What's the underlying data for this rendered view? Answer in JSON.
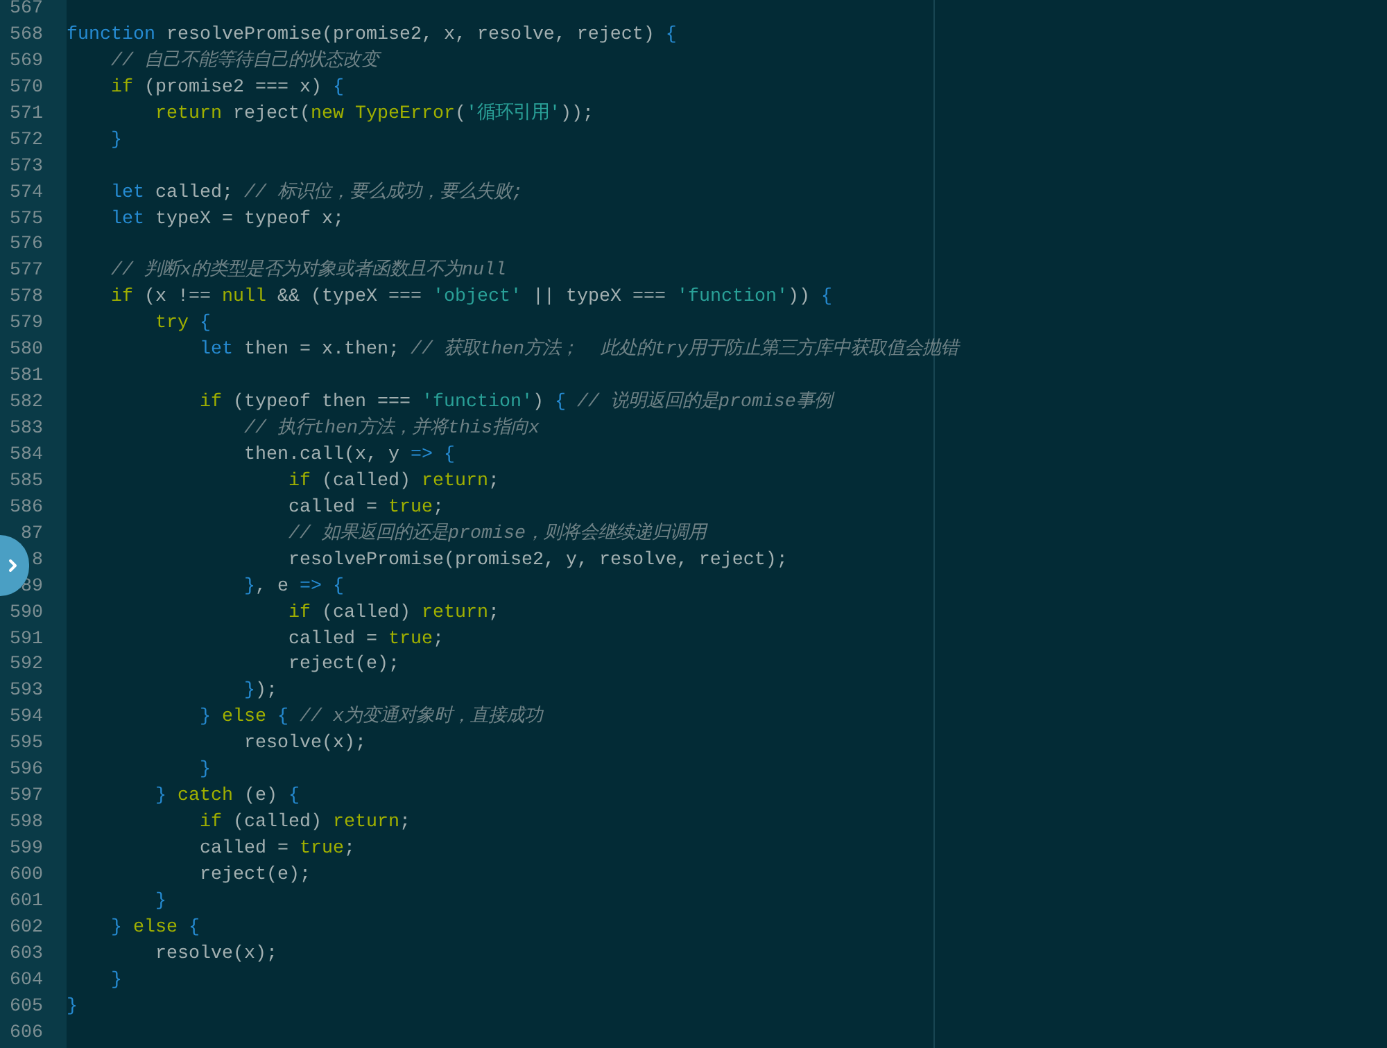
{
  "editor": {
    "lines": [
      {
        "number": "567"
      },
      {
        "number": "568",
        "code": [
          {
            "kind": "keyword",
            "text": "function"
          },
          {
            "kind": "plain",
            "text": " resolvePromise(promise2, x, resolve, reject) "
          },
          {
            "kind": "keyword",
            "text": "{"
          }
        ],
        "children": [
          {
            "number": "569",
            "code": [
              {
                "kind": "comment",
                "text": "// 自己不能等待自己的状态改变"
              }
            ]
          },
          {
            "number": "570",
            "code": [
              {
                "kind": "control",
                "text": "if"
              },
              {
                "kind": "plain",
                "text": " (promise2 === x) "
              },
              {
                "kind": "keyword",
                "text": "{"
              }
            ],
            "children": [
              {
                "number": "571",
                "code": [
                  {
                    "kind": "control",
                    "text": "return"
                  },
                  {
                    "kind": "plain",
                    "text": " reject("
                  },
                  {
                    "kind": "control",
                    "text": "new TypeError"
                  },
                  {
                    "kind": "plain",
                    "text": "("
                  },
                  {
                    "kind": "string",
                    "text": "'循环引用'"
                  },
                  {
                    "kind": "plain",
                    "text": "));"
                  }
                ]
              }
            ]
          },
          {
            "number": "572",
            "code": [
              {
                "kind": "keyword",
                "text": "}"
              }
            ]
          },
          {
            "number": "573"
          },
          {
            "number": "574",
            "code": [
              {
                "kind": "keyword",
                "text": "let"
              },
              {
                "kind": "plain",
                "text": " called; "
              },
              {
                "kind": "comment",
                "text": "// 标识位，要么成功，要么失败;"
              }
            ]
          },
          {
            "number": "575",
            "code": [
              {
                "kind": "keyword",
                "text": "let"
              },
              {
                "kind": "plain",
                "text": " typeX = typeof x;"
              }
            ]
          },
          {
            "number": "576"
          },
          {
            "number": "577",
            "code": [
              {
                "kind": "comment",
                "text": "// 判断x的类型是否为对象或者函数且不为null"
              }
            ]
          },
          {
            "number": "578",
            "code": [
              {
                "kind": "control",
                "text": "if"
              },
              {
                "kind": "plain",
                "text": " (x !== "
              },
              {
                "kind": "control",
                "text": "null"
              },
              {
                "kind": "plain",
                "text": " && (typeX === "
              },
              {
                "kind": "string",
                "text": "'object'"
              },
              {
                "kind": "plain",
                "text": " || typeX === "
              },
              {
                "kind": "string",
                "text": "'function'"
              },
              {
                "kind": "plain",
                "text": ")) "
              },
              {
                "kind": "keyword",
                "text": "{"
              }
            ],
            "children": [
              {
                "number": "579",
                "code": [
                  {
                    "kind": "control",
                    "text": "try"
                  },
                  {
                    "kind": "keyword",
                    "text": " {"
                  }
                ],
                "children": [
                  {
                    "number": "580",
                    "code": [
                      {
                        "kind": "keyword",
                        "text": "let"
                      },
                      {
                        "kind": "plain",
                        "text": " then = x.then; "
                      },
                      {
                        "kind": "comment",
                        "text": "// 获取then方法；  此处的try用于防止第三方库中获取值会抛错"
                      }
                    ]
                  },
                  {
                    "number": "581"
                  },
                  {
                    "number": "582",
                    "code": [
                      {
                        "kind": "control",
                        "text": "if"
                      },
                      {
                        "kind": "plain",
                        "text": " (typeof then === "
                      },
                      {
                        "kind": "string",
                        "text": "'function'"
                      },
                      {
                        "kind": "plain",
                        "text": ") "
                      },
                      {
                        "kind": "keyword",
                        "text": "{"
                      },
                      {
                        "kind": "comment",
                        "text": " // 说明返回的是promise事例"
                      }
                    ],
                    "children": [
                      {
                        "number": "583",
                        "code": [
                          {
                            "kind": "comment",
                            "text": "// 执行then方法，并将this指向x"
                          }
                        ]
                      },
                      {
                        "number": "584",
                        "code": [
                          {
                            "kind": "plain",
                            "text": "then.call(x, y "
                          },
                          {
                            "kind": "keyword",
                            "text": "=> {"
                          }
                        ],
                        "children": [
                          {
                            "number": "585",
                            "code": [
                              {
                                "kind": "control",
                                "text": "if"
                              },
                              {
                                "kind": "plain",
                                "text": " (called) "
                              },
                              {
                                "kind": "control",
                                "text": "return"
                              },
                              {
                                "kind": "plain",
                                "text": ";"
                              }
                            ]
                          },
                          {
                            "number": "586",
                            "code": [
                              {
                                "kind": "plain",
                                "text": "called = "
                              },
                              {
                                "kind": "control",
                                "text": "true"
                              },
                              {
                                "kind": "plain",
                                "text": ";"
                              }
                            ]
                          },
                          {
                            "number": "87",
                            "code": [
                              {
                                "kind": "comment",
                                "text": "// 如果返回的还是promise，则将会继续递归调用"
                              }
                            ]
                          },
                          {
                            "number": "8",
                            "code": [
                              {
                                "kind": "plain",
                                "text": "resolvePromise(promise2, y, resolve, reject);"
                              }
                            ]
                          }
                        ]
                      },
                      {
                        "number": "89",
                        "code": [
                          {
                            "kind": "keyword",
                            "text": "}"
                          },
                          {
                            "kind": "plain",
                            "text": ", e "
                          },
                          {
                            "kind": "keyword",
                            "text": "=> {"
                          }
                        ],
                        "children": [
                          {
                            "number": "590",
                            "code": [
                              {
                                "kind": "control",
                                "text": "if"
                              },
                              {
                                "kind": "plain",
                                "text": " (called) "
                              },
                              {
                                "kind": "control",
                                "text": "return"
                              },
                              {
                                "kind": "plain",
                                "text": ";"
                              }
                            ]
                          },
                          {
                            "number": "591",
                            "code": [
                              {
                                "kind": "plain",
                                "text": "called = "
                              },
                              {
                                "kind": "control",
                                "text": "true"
                              },
                              {
                                "kind": "plain",
                                "text": ";"
                              }
                            ]
                          },
                          {
                            "number": "592",
                            "code": [
                              {
                                "kind": "plain",
                                "text": "reject(e);"
                              }
                            ]
                          }
                        ]
                      },
                      {
                        "number": "593",
                        "code": [
                          {
                            "kind": "keyword",
                            "text": "}"
                          },
                          {
                            "kind": "plain",
                            "text": ");"
                          }
                        ]
                      }
                    ]
                  },
                  {
                    "number": "594",
                    "code": [
                      {
                        "kind": "keyword",
                        "text": "}"
                      },
                      {
                        "kind": "control",
                        "text": " else"
                      },
                      {
                        "kind": "keyword",
                        "text": " {"
                      },
                      {
                        "kind": "comment",
                        "text": " // x为变通对象时，直接成功"
                      }
                    ],
                    "children": [
                      {
                        "number": "595",
                        "code": [
                          {
                            "kind": "plain",
                            "text": "resolve(x);"
                          }
                        ]
                      }
                    ]
                  },
                  {
                    "number": "596",
                    "code": [
                      {
                        "kind": "keyword",
                        "text": "}"
                      }
                    ]
                  }
                ]
              },
              {
                "number": "597",
                "code": [
                  {
                    "kind": "keyword",
                    "text": "}"
                  },
                  {
                    "kind": "control",
                    "text": " catch"
                  },
                  {
                    "kind": "plain",
                    "text": " (e) "
                  },
                  {
                    "kind": "keyword",
                    "text": "{"
                  }
                ],
                "children": [
                  {
                    "number": "598",
                    "code": [
                      {
                        "kind": "control",
                        "text": "if"
                      },
                      {
                        "kind": "plain",
                        "text": " (called) "
                      },
                      {
                        "kind": "control",
                        "text": "return"
                      },
                      {
                        "kind": "plain",
                        "text": ";"
                      }
                    ]
                  },
                  {
                    "number": "599",
                    "code": [
                      {
                        "kind": "plain",
                        "text": "called = "
                      },
                      {
                        "kind": "control",
                        "text": "true"
                      },
                      {
                        "kind": "plain",
                        "text": ";"
                      }
                    ]
                  },
                  {
                    "number": "600",
                    "code": [
                      {
                        "kind": "plain",
                        "text": "reject(e);"
                      }
                    ]
                  }
                ]
              },
              {
                "number": "601",
                "code": [
                  {
                    "kind": "keyword",
                    "text": "}"
                  }
                ]
              }
            ]
          },
          {
            "number": "602",
            "code": [
              {
                "kind": "keyword",
                "text": "}"
              },
              {
                "kind": "control",
                "text": " else"
              },
              {
                "kind": "keyword",
                "text": " {"
              }
            ],
            "children": [
              {
                "number": "603",
                "code": [
                  {
                    "kind": "plain",
                    "text": "resolve(x);"
                  }
                ]
              }
            ]
          },
          {
            "number": "604",
            "code": [
              {
                "kind": "keyword",
                "text": "}"
              }
            ]
          }
        ]
      },
      {
        "number": "605",
        "code": [
          {
            "kind": "keyword",
            "text": "}"
          }
        ]
      },
      {
        "number": "606"
      }
    ]
  }
}
